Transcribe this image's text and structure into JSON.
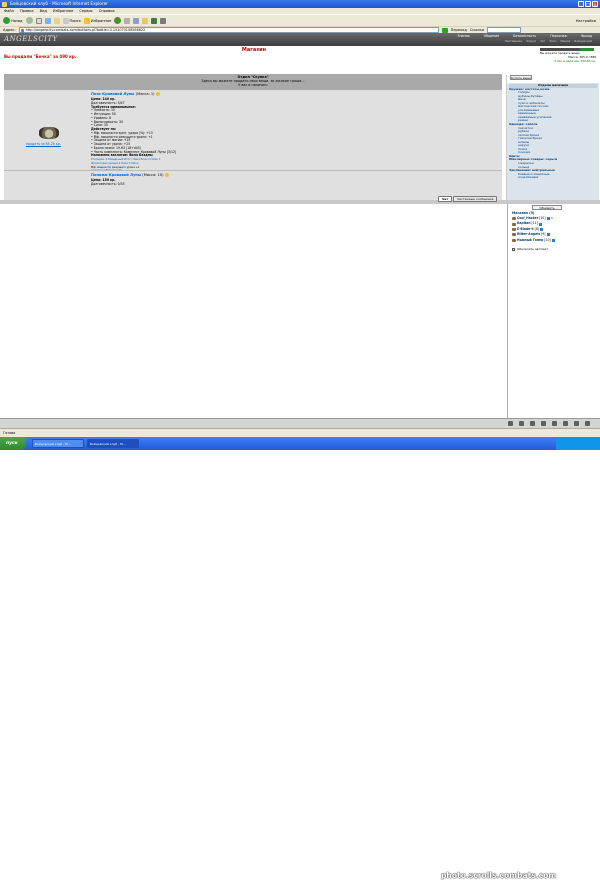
{
  "window": {
    "title": "Бойцовский клуб - Microsoft Internet Explorer"
  },
  "menu": [
    "Файл",
    "Правка",
    "Вид",
    "Избранное",
    "Сервис",
    "Справка"
  ],
  "toolbar": {
    "back": "Назад",
    "search": "Поиск",
    "favorites": "Избранное",
    "go": "Переход",
    "links": "Ссылки",
    "settings": "Настройки"
  },
  "address": {
    "label": "Адрес:",
    "url": "http://angelscity.combats.com/buttons.pl?battle=0.101070108566622"
  },
  "game": {
    "logo": "ANGELSCITY",
    "nav": [
      "Знания",
      "Общение",
      "Безопасность",
      "Персонаж",
      "Выход"
    ],
    "subnav": [
      "Наставники",
      "Форум",
      "Чат",
      "Логи",
      "Мешок",
      "Бойцовский"
    ]
  },
  "shop": {
    "title": "Магазин",
    "sold_message": "Вы продали \"Бочка\" за 490 кр.",
    "money": {
      "line1": "Вы можете продать вещи",
      "line2": "Масса: 365.0 / 888",
      "line3": "У вас в наличии: 420.83 кр."
    },
    "buy_button": "Купить вещи",
    "department": {
      "title": "Отдел \"Скупка\"",
      "desc": "Здесь вы можете продать свои вещи, за жалкие гроши...",
      "hint": "У вас в наличии:"
    },
    "items": [
      {
        "name": "Пояс Кровавой Луны",
        "mass": "(Масса: 1)",
        "sell": "продать за 65.25 кр.",
        "lines": [
          {
            "t": "Цена: 140 кр.",
            "c": "b"
          },
          {
            "t": "Долговечность: 5/47",
            "c": ""
          },
          {
            "t": "Требуется минимальное:",
            "c": "b"
          },
          {
            "t": "• Ловкость: 15",
            "c": ""
          },
          {
            "t": "• Интуиция: 50",
            "c": ""
          },
          {
            "t": "• Уровень: 8",
            "c": ""
          },
          {
            "t": "• Выносливость: 30",
            "c": ""
          },
          {
            "t": "• Сила: 30",
            "c": ""
          },
          {
            "t": "Действует на:",
            "c": "b"
          },
          {
            "t": "• Мф. мощности крит. удара (%): +15",
            "c": ""
          },
          {
            "t": "• Мф. мощности режущего урона: +1",
            "c": ""
          },
          {
            "t": "• Защита от магии: +25",
            "c": ""
          },
          {
            "t": "• Защита от урона: +25",
            "c": ""
          },
          {
            "t": "• Броня пояса: 19-63 (18+d45)",
            "c": ""
          },
          {
            "t": "• Часть комплекта: Комплект Кровавой Луны [3/12]",
            "c": ""
          },
          {
            "t": "Наложено заклятие: Воля Бездны",
            "c": "b"
          },
          {
            "t": "Усиление: 4 Бездарный Вотс / Пеня Волн Стойки 1",
            "c": "blue sm"
          },
          {
            "t": "Фиолетовая уровня 4 Вора Стойки",
            "c": "blue sm"
          },
          {
            "t": "Мф. мощности режущего урона +1",
            "c": "sm"
          },
          {
            "t": "Сделано в Emerald city",
            "c": "red sm"
          }
        ]
      },
      {
        "name": "Поножи Кровавой Луны",
        "mass": "(Масса: 10)",
        "lines": [
          {
            "t": "Цена: 150 кр.",
            "c": "b"
          },
          {
            "t": "Долговечность: 0/35",
            "c": ""
          }
        ]
      }
    ]
  },
  "categories": {
    "header": "Отдела магазина",
    "groups": [
      {
        "name": "Оружие: кастеты,ножи",
        "subs": [
          "топоры",
          "дубины,булавы",
          "мечи",
          "луки и арбалеты",
          "магические посохи",
          "усиливаемые",
          "временные",
          "кривяемые усиления",
          "ремни"
        ]
      },
      {
        "name": "Одежда: сапоги",
        "subs": [
          "перчатки",
          "рубахи",
          "легкая броня",
          "тяжелая броня",
          "шлемы",
          "наручи",
          "пояса",
          "поножи"
        ]
      },
      {
        "name": "Щиты",
        "subs": []
      },
      {
        "name": "Ювелирные товары: серьги",
        "subs": [
          "ожерелья",
          "кольца"
        ]
      },
      {
        "name": "Заклинания: нейтральные",
        "subs": [
          "боевые и защитные",
          "исцеляющие"
        ]
      }
    ]
  },
  "tabs": [
    "Чат",
    "Системные сообщения"
  ],
  "chat_panel": {
    "refresh": "Обновить",
    "shop_title": "Магазин (5)",
    "users": [
      {
        "name": "Cool_Hacker",
        "level": "[10]"
      },
      {
        "name": "Kapitan",
        "level": "[11]"
      },
      {
        "name": "E-Blade-ll",
        "level": "[8]"
      },
      {
        "name": "Ritter-Angels",
        "level": "[9]"
      },
      {
        "name": "Ньюный Гонер",
        "level": "[10]"
      }
    ],
    "auto_refresh": "Обновлять автомат."
  },
  "statusbar": {
    "text": "Готово"
  },
  "taskbar": {
    "start": "пуск",
    "tasks": [
      "Бойцовский клуб - M...",
      "Бойцовский клуб - M..."
    ],
    "clock": "photo.scrolls.combats.com"
  }
}
